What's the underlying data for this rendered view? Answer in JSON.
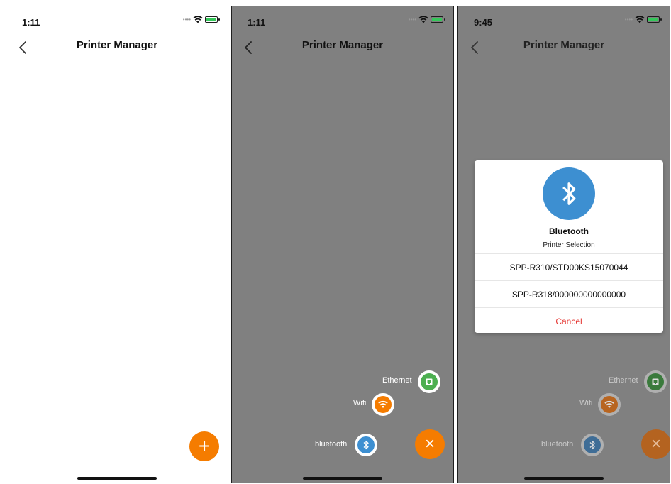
{
  "screens": [
    {
      "status_time": "1:11",
      "nav_title": "Printer Manager",
      "fab_icon": "+"
    },
    {
      "status_time": "1:11",
      "nav_title": "Printer Manager",
      "fab_icon": "×",
      "options": {
        "ethernet": "Ethernet",
        "wifi": "Wifi",
        "bluetooth": "bluetooth"
      }
    },
    {
      "status_time": "9:45",
      "nav_title": "Printer Manager",
      "fab_icon": "×",
      "options": {
        "ethernet": "Ethernet",
        "wifi": "Wifi",
        "bluetooth": "bluetooth"
      },
      "dialog": {
        "title": "Bluetooth",
        "subtitle": "Printer Selection",
        "printers": [
          "SPP-R310/STD00KS15070044",
          "SPP-R318/000000000000000"
        ],
        "cancel": "Cancel"
      }
    }
  ],
  "icons": {
    "back": "chevron-left-icon",
    "ethernet": "ethernet-port-icon",
    "wifi": "wifi-icon",
    "bluetooth": "bluetooth-icon",
    "add": "plus-icon",
    "close": "close-icon"
  },
  "colors": {
    "accent_orange": "#f57c00",
    "bluetooth_blue": "#3d8fd1",
    "ethernet_green": "#4caf50",
    "cancel_red": "#e53935",
    "overlay_gray": "#808080",
    "battery_green": "#34c759"
  }
}
